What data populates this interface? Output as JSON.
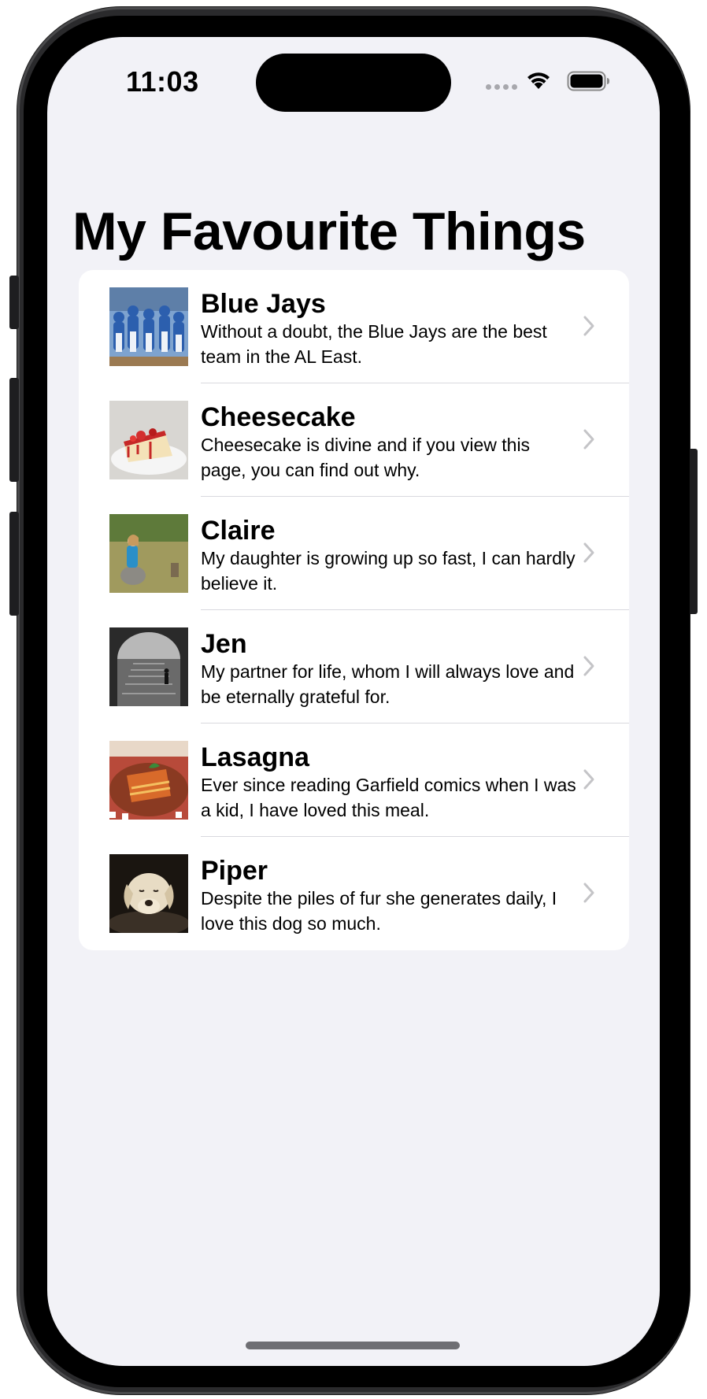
{
  "status_bar": {
    "time": "11:03"
  },
  "page": {
    "title": "My Favourite Things"
  },
  "items": [
    {
      "title": "Blue Jays",
      "description": "Without a doubt, the Blue Jays are the best team in the AL East.",
      "thumbnail": "baseball-team-photo"
    },
    {
      "title": "Cheesecake",
      "description": "Cheesecake is divine and if you view this page, you can find out why.",
      "thumbnail": "cheesecake-photo"
    },
    {
      "title": "Claire",
      "description": "My daughter is growing up so fast, I can hardly believe it.",
      "thumbnail": "girl-on-rock-photo"
    },
    {
      "title": "Jen",
      "description": "My partner for life, whom I will always love and be eternally grateful for.",
      "thumbnail": "stone-stairs-photo"
    },
    {
      "title": "Lasagna",
      "description": "Ever since reading Garfield comics when I was a kid, I have loved this meal.",
      "thumbnail": "lasagna-photo"
    },
    {
      "title": "Piper",
      "description": "Despite the piles of fur she generates daily, I love this dog so much.",
      "thumbnail": "dog-photo"
    }
  ],
  "colors": {
    "background": "#f2f2f7",
    "card": "#ffffff",
    "chevron": "#c4c4c7",
    "separator": "#d9d9de"
  }
}
